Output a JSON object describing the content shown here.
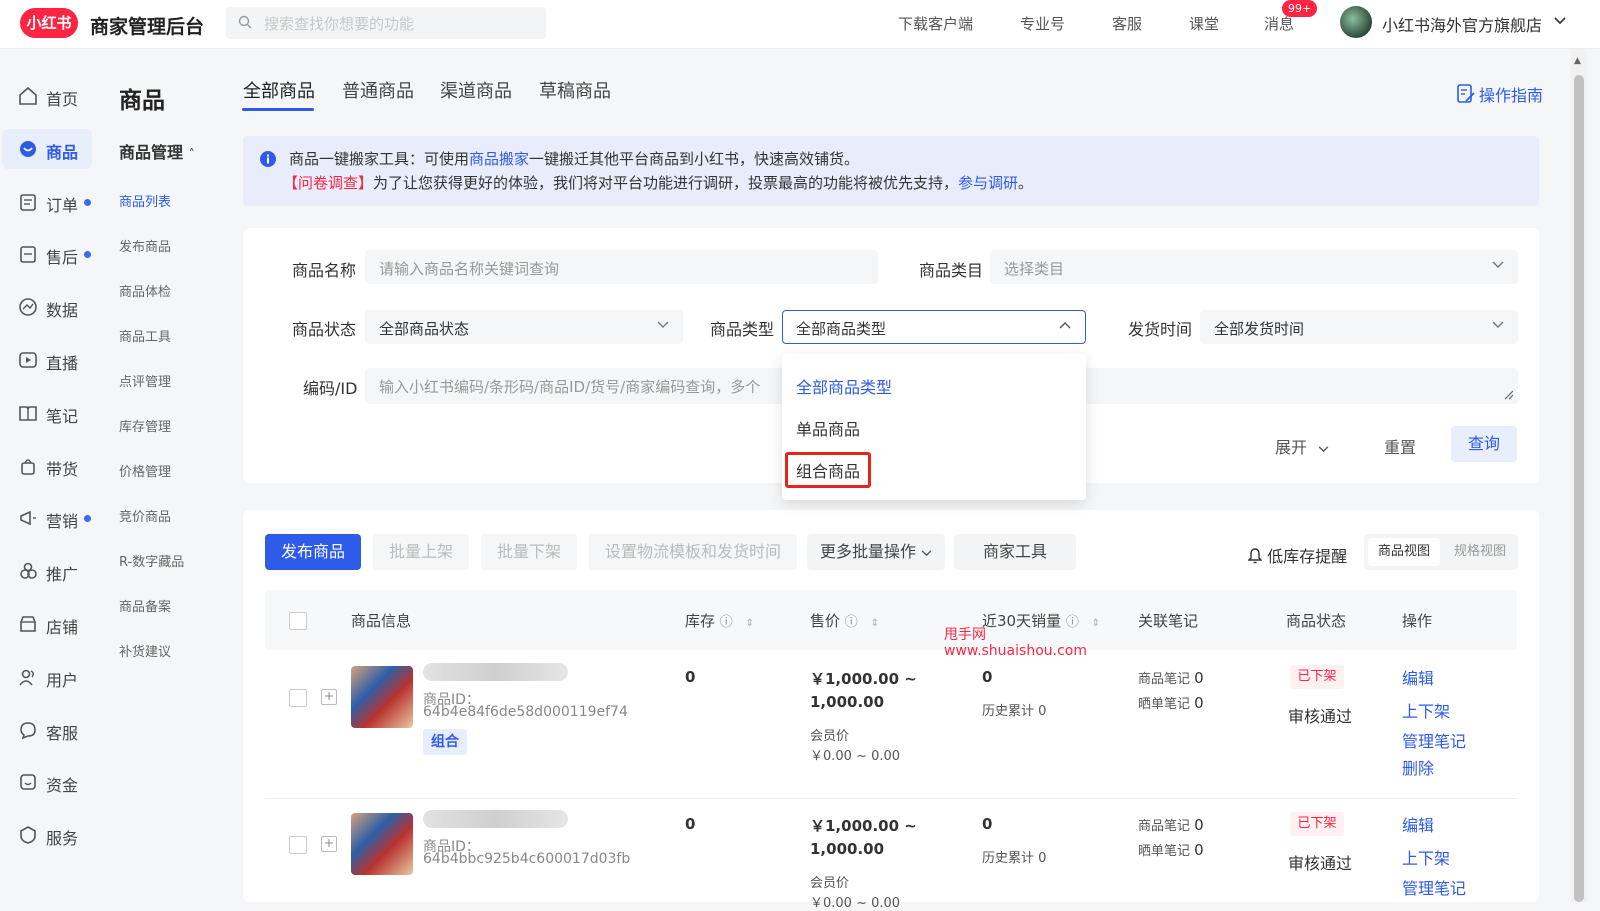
{
  "header": {
    "logo_text": "小红书",
    "app_title": "商家管理后台",
    "search_placeholder": "搜索查找你想要的功能",
    "links": [
      "下载客户端",
      "专业号",
      "客服",
      "课堂",
      "消息"
    ],
    "message_badge": "99+",
    "shop_name": "小红书海外官方旗舰店"
  },
  "leftnav": [
    {
      "label": "首页",
      "icon": "home-icon",
      "dot": false
    },
    {
      "label": "商品",
      "icon": "goods-icon",
      "dot": false,
      "active": true
    },
    {
      "label": "订单",
      "icon": "order-icon",
      "dot": true
    },
    {
      "label": "售后",
      "icon": "aftersale-icon",
      "dot": true
    },
    {
      "label": "数据",
      "icon": "data-icon",
      "dot": false
    },
    {
      "label": "直播",
      "icon": "live-icon",
      "dot": false
    },
    {
      "label": "笔记",
      "icon": "notes-icon",
      "dot": false
    },
    {
      "label": "带货",
      "icon": "bag-icon",
      "dot": false
    },
    {
      "label": "营销",
      "icon": "marketing-icon",
      "dot": true
    },
    {
      "label": "推广",
      "icon": "promote-icon",
      "dot": false
    },
    {
      "label": "店铺",
      "icon": "store-icon",
      "dot": false
    },
    {
      "label": "用户",
      "icon": "users-icon",
      "dot": false
    },
    {
      "label": "客服",
      "icon": "service-icon",
      "dot": false
    },
    {
      "label": "资金",
      "icon": "funds-icon",
      "dot": false
    },
    {
      "label": "服务",
      "icon": "services-icon",
      "dot": false
    }
  ],
  "subnav": {
    "title": "商品",
    "group": "商品管理",
    "items": [
      "商品列表",
      "发布商品",
      "商品体检",
      "商品工具",
      "点评管理",
      "库存管理",
      "价格管理",
      "竞价商品",
      "R-数字藏品",
      "商品备案",
      "补货建议"
    ]
  },
  "tabs": [
    "全部商品",
    "普通商品",
    "渠道商品",
    "草稿商品"
  ],
  "guide_label": "操作指南",
  "notice": {
    "line1_pre": "商品一键搬家工具：可使用",
    "line1_link": "商品搬家",
    "line1_post": "一键搬迁其他平台商品到小红书，快速高效铺货。",
    "line2_red": "【问卷调查】",
    "line2_text": "为了让您获得更好的体验，我们将对平台功能进行调研，投票最高的功能将被优先支持，",
    "line2_link": "参与调研",
    "line2_end": "。"
  },
  "filters": {
    "name_label": "商品名称",
    "name_placeholder": "请输入商品名称关键词查询",
    "category_label": "商品类目",
    "category_placeholder": "选择类目",
    "status_label": "商品状态",
    "status_value": "全部商品状态",
    "type_label": "商品类型",
    "type_value": "全部商品类型",
    "ship_label": "发货时间",
    "ship_value": "全部发货时间",
    "code_label": "编码/ID",
    "code_placeholder": "输入小红书编码/条形码/商品ID/货号/商家编码查询，多个",
    "expand_label": "展开",
    "reset_label": "重置",
    "query_label": "查询"
  },
  "dropdown": {
    "options": [
      "全部商品类型",
      "单品商品",
      "组合商品"
    ],
    "selected": "全部商品类型",
    "highlighted": "组合商品"
  },
  "toolbar": {
    "publish": "发布商品",
    "batch_on": "批量上架",
    "batch_off": "批量下架",
    "logistics": "设置物流模板和发货时间",
    "more_batch": "更多批量操作",
    "merchant_tools": "商家工具",
    "low_stock": "低库存提醒",
    "view_goods": "商品视图",
    "view_spec": "规格视图"
  },
  "table": {
    "headers": [
      "商品信息",
      "库存",
      "售价",
      "近30天销量",
      "关联笔记",
      "商品状态",
      "操作"
    ],
    "rows": [
      {
        "id_label": "商品ID：",
        "id": "64b4e84f6de58d000119ef74",
        "tag": "组合",
        "stock": "0",
        "price_1": "￥1,000.00 ~",
        "price_2": "1,000.00",
        "member_label": "会员价",
        "member_price": "￥0.00 ~ 0.00",
        "sales": "0",
        "history": "历史累计 0",
        "note_goods": "商品笔记",
        "note_goods_count": "0",
        "note_show": "晒单笔记",
        "note_show_count": "0",
        "status": "已下架",
        "review": "审核通过",
        "ops": [
          "编辑",
          "上下架",
          "管理笔记",
          "删除"
        ]
      },
      {
        "id_label": "商品ID：",
        "id": "64b4bbc925b4c600017d03fb",
        "stock": "0",
        "price_1": "￥1,000.00 ~",
        "price_2": "1,000.00",
        "member_label": "会员价",
        "member_price": "￥0.00 ~ 0.00",
        "sales": "0",
        "history": "历史累计 0",
        "note_goods": "商品笔记",
        "note_goods_count": "0",
        "note_show": "晒单笔记",
        "note_show_count": "0",
        "status": "已下架",
        "review": "审核通过",
        "ops": [
          "编辑",
          "上下架",
          "管理笔记"
        ]
      }
    ]
  },
  "watermark": {
    "line1": "甩手网",
    "line2": "www.shuaishou.com"
  },
  "colors": {
    "accent": "#2e5bea",
    "brand": "#ff2442"
  }
}
